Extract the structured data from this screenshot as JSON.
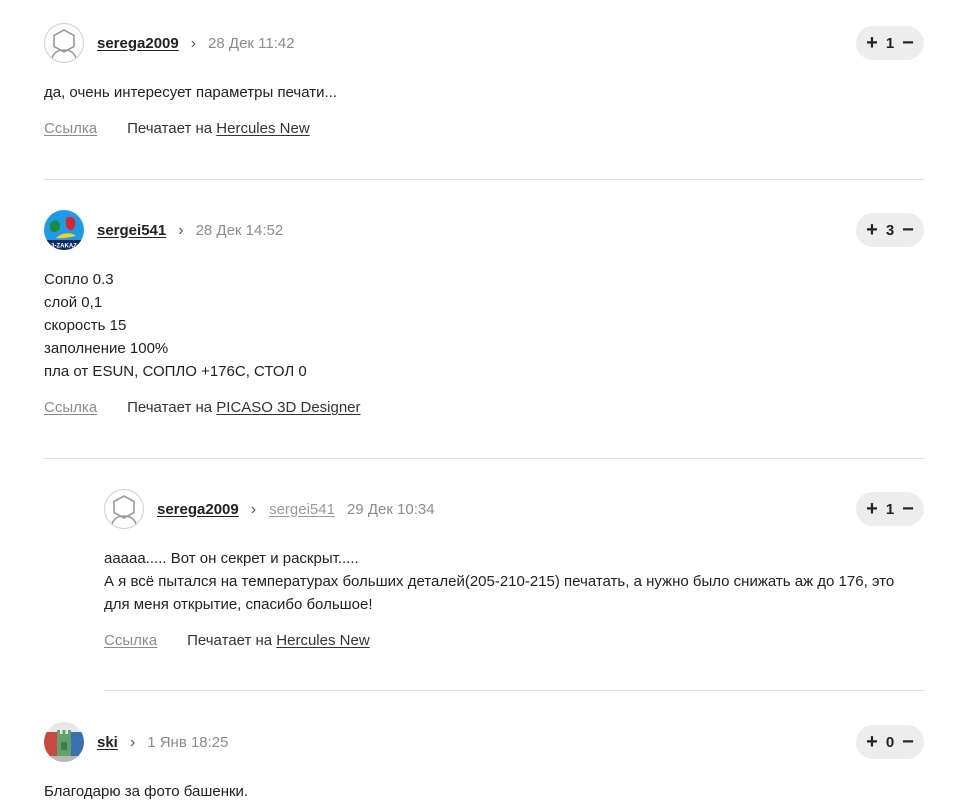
{
  "comments": [
    {
      "author": "serega2009",
      "reply_to": "",
      "date": "28 Дек 11:42",
      "votes": "1",
      "lines": [
        "да, очень интересует параметры печати..."
      ],
      "link_label": "Ссылка",
      "prints_prefix": "Печатает на",
      "printer": "Hercules New",
      "avatar": "default-avatar-icon"
    },
    {
      "author": "sergei541",
      "reply_to": "",
      "date": "28 Дек 14:52",
      "votes": "3",
      "lines": [
        "Сопло 0.3",
        "слой 0,1",
        "скорость 15",
        "заполнение 100%",
        "пла от ESUN, СОПЛО +176C, СТОЛ 0"
      ],
      "link_label": "Ссылка",
      "prints_prefix": "Печатает на",
      "printer": "PICASO 3D Designer",
      "avatar": "logo-avatar",
      "avatar_logo_text": "3-ZAKAZ"
    },
    {
      "author": "serega2009",
      "reply_to": "sergei541",
      "date": "29 Дек 10:34",
      "votes": "1",
      "lines": [
        "ааааа..... Вот он секрет и раскрыт.....",
        "А я всё пытался на температурах больших деталей(205-210-215) печатать, а нужно было снижать аж до 176, это для меня открытие, спасибо большое!"
      ],
      "link_label": "Ссылка",
      "prints_prefix": "Печатает на",
      "printer": "Hercules New",
      "avatar": "default-avatar-icon"
    },
    {
      "author": "ski",
      "reply_to": "",
      "date": "1 Янв 18:25",
      "votes": "0",
      "lines": [
        "Благодарю за фото башенки."
      ],
      "avatar": "tower-photo-avatar"
    }
  ],
  "vote": {
    "plus": "+",
    "minus": "−"
  },
  "colors": {
    "text": "#222222",
    "muted": "#8c8c8c",
    "vote_bg": "#ededed",
    "divider": "#dddddd"
  }
}
